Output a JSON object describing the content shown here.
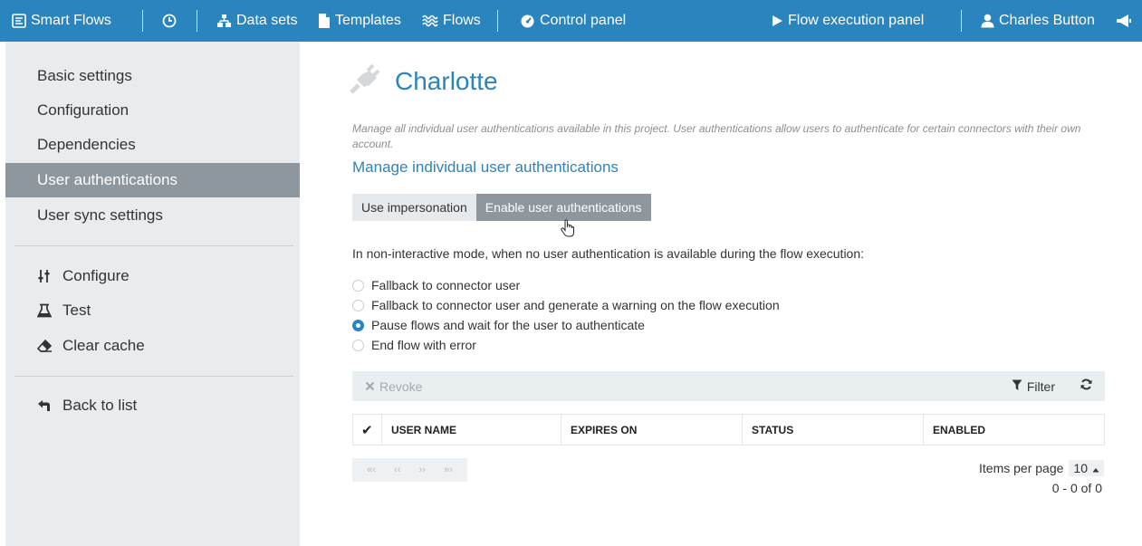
{
  "topbar": {
    "brand": "Smart Flows",
    "nav": [
      {
        "label": "Data sets",
        "icon": "sitemap-icon"
      },
      {
        "label": "Templates",
        "icon": "file-icon"
      },
      {
        "label": "Flows",
        "icon": "wave-icon"
      },
      {
        "label": "Control panel",
        "icon": "gauge-icon"
      }
    ],
    "execution_panel": "Flow execution panel",
    "user": "Charles Button",
    "colors": {
      "bar": "#2a84bd",
      "text": "#ffffff"
    }
  },
  "sidebar": {
    "items": [
      {
        "label": "Basic settings"
      },
      {
        "label": "Configuration"
      },
      {
        "label": "Dependencies"
      },
      {
        "label": "User authentications",
        "active": true
      },
      {
        "label": "User sync settings"
      }
    ],
    "actions": [
      {
        "label": "Configure",
        "icon": "sliders-icon"
      },
      {
        "label": "Test",
        "icon": "flask-icon"
      },
      {
        "label": "Clear cache",
        "icon": "eraser-icon"
      }
    ],
    "back": {
      "label": "Back to list",
      "icon": "back-arrow-icon"
    }
  },
  "main": {
    "title": "Charlotte",
    "description": "Manage all individual user authentications available in this project. User authentications allow users to authenticate for certain connectors with their own account.",
    "manage_link": "Manage individual user authentications",
    "mode_buttons": [
      {
        "label": "Use impersonation",
        "active": false
      },
      {
        "label": "Enable user authentications",
        "active": true
      }
    ],
    "mode_text": "In non-interactive mode, when no user authentication is available during the flow execution:",
    "options": [
      {
        "label": "Fallback to connector user",
        "checked": false
      },
      {
        "label": "Fallback to connector user and generate a warning on the flow execution",
        "checked": false
      },
      {
        "label": "Pause flows and wait for the user to authenticate",
        "checked": true
      },
      {
        "label": "End flow with error",
        "checked": false
      }
    ],
    "toolbar": {
      "revoke": "Revoke",
      "filter": "Filter"
    },
    "grid": {
      "check_mark": "✔",
      "columns": [
        "USER NAME",
        "EXPIRES ON",
        "STATUS",
        "ENABLED"
      ]
    },
    "pager": {
      "buttons": [
        "«‹",
        "‹‹",
        "››",
        "»›"
      ],
      "items_per_page_label": "Items per page",
      "items_per_page_value": "10",
      "range": "0 - 0 of 0"
    }
  }
}
